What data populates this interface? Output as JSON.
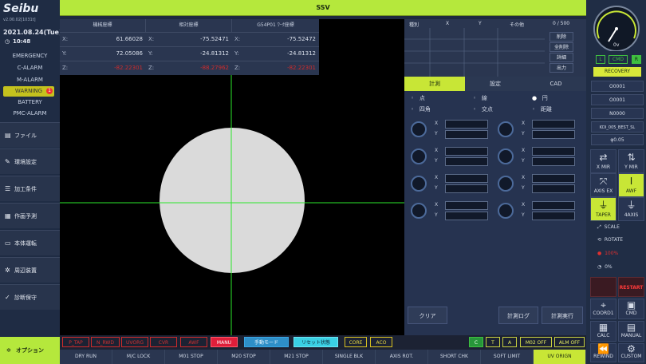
{
  "header": {
    "title": "SSV"
  },
  "brand": {
    "logo": "Seibu",
    "version": "v2.00.02[1031t]",
    "date": "2021.08.24(Tue)",
    "time": "10:48"
  },
  "alarms": [
    "EMERGENCY",
    "C-ALARM",
    "M-ALARM",
    "WARNING",
    "BATTERY",
    "PMC-ALARM"
  ],
  "warning_badge": "1",
  "menu": [
    {
      "label": "ファイル",
      "icon": "folder-icon"
    },
    {
      "label": "環境設定",
      "icon": "wrench-icon"
    },
    {
      "label": "加工条件",
      "icon": "list-icon"
    },
    {
      "label": "作画予測",
      "icon": "grid-icon"
    },
    {
      "label": "本体運転",
      "icon": "monitor-icon"
    },
    {
      "label": "周辺装置",
      "icon": "gear-icon"
    },
    {
      "label": "診断保守",
      "icon": "check-icon"
    }
  ],
  "option_label": "オプション",
  "coords": {
    "headers": [
      "機械座標",
      "相対座標",
      "G54P01 ﾜｰｸ座標"
    ],
    "rows": [
      {
        "axis": "X:",
        "values": [
          "61.66028",
          "-75.52471",
          "-75.52472"
        ],
        "red": false
      },
      {
        "axis": "Y:",
        "values": [
          "72.05086",
          "-24.81312",
          "-24.81312"
        ],
        "red": false
      },
      {
        "axis": "Z:",
        "values": [
          "-82.22301",
          "-88.27962",
          "-82.22301"
        ],
        "red": true
      }
    ]
  },
  "list": {
    "headers": [
      "種別",
      "X",
      "Y",
      "その他"
    ],
    "count": "0 / 500",
    "buttons": [
      "削除",
      "全削除",
      "詳細",
      "出力"
    ]
  },
  "tabs": [
    "計測",
    "設定",
    "CAD"
  ],
  "measure": {
    "radios": [
      "点",
      "線",
      "円",
      "四角",
      "交点",
      "距離"
    ],
    "x_label": "X",
    "y_label": "Y",
    "clear": "クリア",
    "log": "計測ログ",
    "run": "計測実行"
  },
  "status": {
    "left": [
      "P_TAP",
      "N_RWD",
      "UVORG",
      "CVR",
      "AWF",
      "MANU"
    ],
    "mode": "手動モード",
    "reset": "リセット状態",
    "core": "CORE",
    "aco": "ACO",
    "right": [
      "C",
      "T",
      "A",
      "M02 OFF",
      "ALM OFF"
    ]
  },
  "functions": [
    "DRY RUN",
    "M/C LOCK",
    "M01 STOP",
    "M20 STOP",
    "M21 STOP",
    "SINGLE BLK",
    "AXIS ROT.",
    "SHORT CHK",
    "SOFT LIMIT",
    "UV ORIGN"
  ],
  "gauge": {
    "value": "0v",
    "l": "L",
    "cmd": "CMD",
    "r": "R",
    "recovery": "RECOVERY"
  },
  "right_info": [
    "O0001",
    "O0001",
    "N0000",
    "KDI_005_BEST_SL",
    "φ0.05"
  ],
  "right_icons": [
    {
      "label": "X MIR",
      "on": false
    },
    {
      "label": "Y MIR",
      "on": false
    },
    {
      "label": "AXIS EX",
      "on": false
    },
    {
      "label": "AWF",
      "on": true
    },
    {
      "label": "TAPER",
      "on": true
    },
    {
      "label": "4AXIS",
      "on": false
    }
  ],
  "scale": "SCALE",
  "rotate": "ROTATE",
  "rotate_pct": "100%",
  "zero_pct": "0%",
  "restart": "RESTART",
  "bottom_icons": [
    "COORD1",
    "CMD",
    "CALC",
    "MANUAL",
    "REWIND",
    "CUSTOM"
  ]
}
